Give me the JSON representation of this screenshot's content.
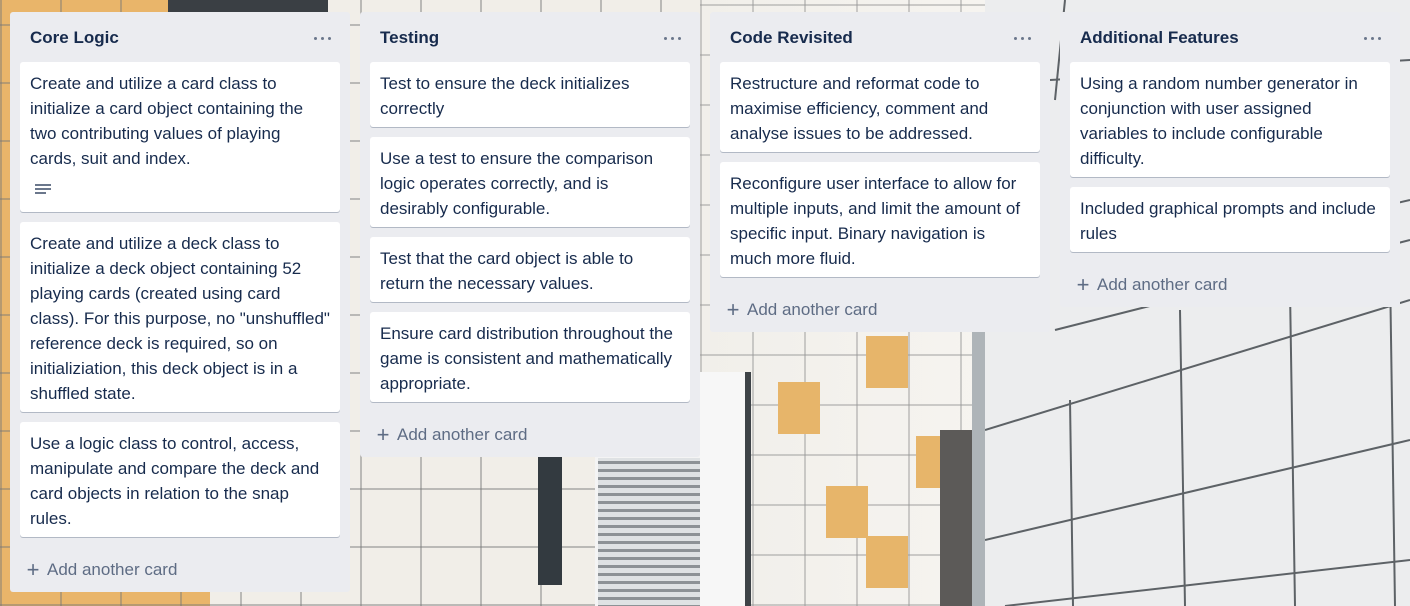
{
  "lists": [
    {
      "title": "Core Logic",
      "cards": [
        "Create and utilize a card class to initialize a card object containing the two contributing values of playing cards, suit and index.",
        "Create and utilize a deck class to initialize a deck object containing 52 playing cards (created using card class). For this purpose, no \"unshuffled\" reference deck is required, so on initializiation, this deck object is in a shuffled state.",
        "Use a logic class to control, access, manipulate and compare the deck and card objects in relation to the snap rules."
      ],
      "add_card_label": "Add another card"
    },
    {
      "title": "Testing",
      "cards": [
        "Test to ensure the deck initializes correctly",
        "Use a test to ensure the comparison logic operates correctly, and is desirably configurable.",
        "Test that the card object is able to return the necessary values.",
        "Ensure card distribution throughout the game is consistent and mathematically appropriate."
      ],
      "add_card_label": "Add another card"
    },
    {
      "title": "Code Revisited",
      "cards": [
        "Restructure and reformat code to maximise efficiency, comment and analyse issues to be addressed.",
        "Reconfigure user interface to allow for multiple inputs, and limit the amount of specific input. Binary navigation is much more fluid."
      ],
      "add_card_label": "Add another card"
    },
    {
      "title": "Additional Features",
      "cards": [
        "Using a random number generator in conjunction with user assigned variables to include configurable difficulty.",
        "Included graphical prompts and include rules"
      ],
      "add_card_label": "Add another card"
    }
  ],
  "icons": {
    "list_menu": "ellipsis-icon",
    "card_description": "description-icon",
    "add": "plus-icon"
  },
  "colors": {
    "list_background": "#ebecf0",
    "card_background": "#ffffff",
    "text": "#172b4d",
    "muted_text": "#5e6c84"
  }
}
